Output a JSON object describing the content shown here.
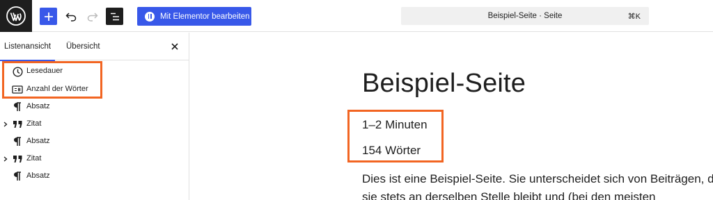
{
  "toolbar": {
    "elementor_label": "Mit Elementor bearbeiten",
    "command_text": "Beispiel-Seite · Seite",
    "command_shortcut": "⌘K"
  },
  "sidebar": {
    "tabs": [
      {
        "label": "Listenansicht",
        "active": true
      },
      {
        "label": "Übersicht",
        "active": false
      }
    ],
    "items": [
      {
        "label": "Lesedauer",
        "icon": "clock-icon",
        "expandable": false
      },
      {
        "label": "Anzahl der Wörter",
        "icon": "word-count-icon",
        "expandable": false
      },
      {
        "label": "Absatz",
        "icon": "paragraph-icon",
        "expandable": false
      },
      {
        "label": "Zitat",
        "icon": "quote-icon",
        "expandable": true
      },
      {
        "label": "Absatz",
        "icon": "paragraph-icon",
        "expandable": false
      },
      {
        "label": "Zitat",
        "icon": "quote-icon",
        "expandable": true
      },
      {
        "label": "Absatz",
        "icon": "paragraph-icon",
        "expandable": false
      }
    ]
  },
  "content": {
    "title": "Beispiel-Seite",
    "reading_time": "1–2 Minuten",
    "word_count": "154 Wörter",
    "paragraph": "Dies ist eine Beispiel-Seite. Sie unterscheidet sich von Beiträgen, da sie stets an derselben Stelle bleibt und (bei den meisten"
  },
  "colors": {
    "accent": "#3858e9",
    "highlight": "#f26522",
    "dark": "#1e1e1e"
  }
}
